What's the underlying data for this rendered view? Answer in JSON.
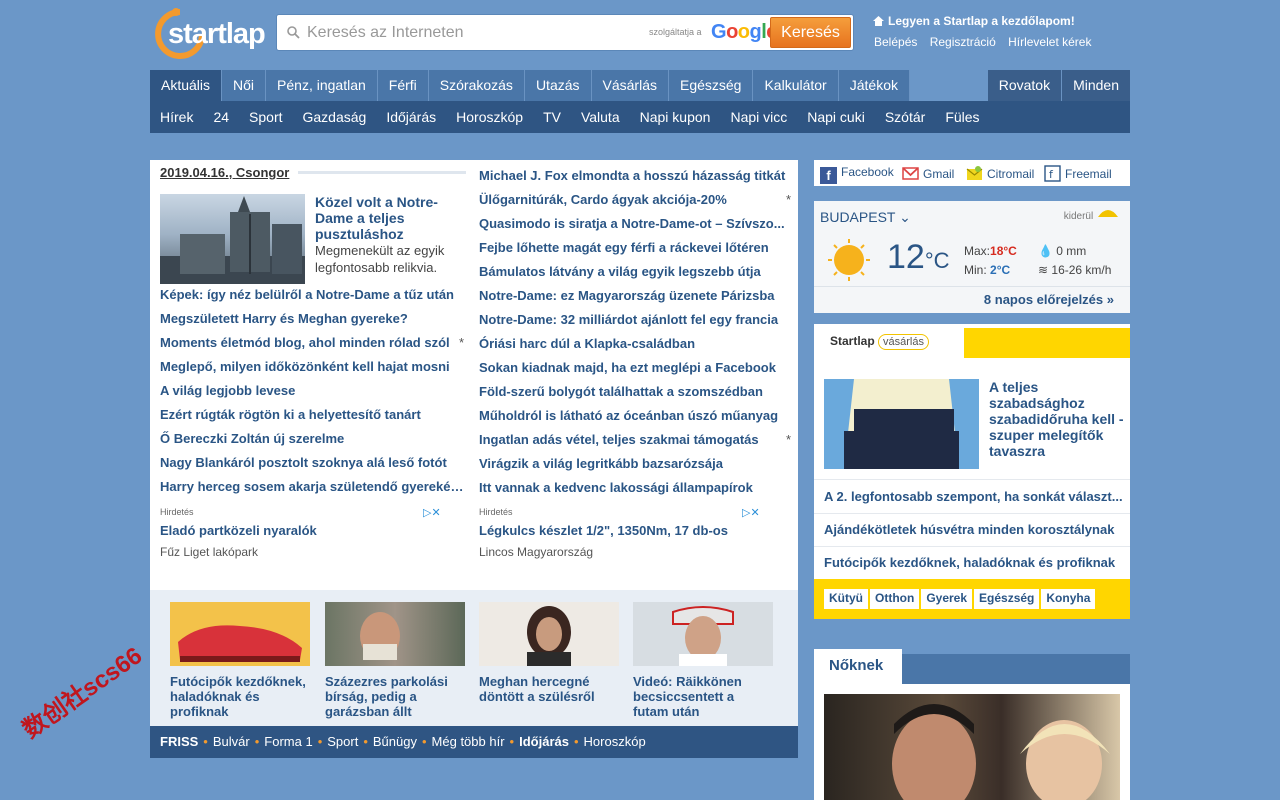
{
  "header": {
    "logo_text": "startlap",
    "search_placeholder": "Keresés az Interneten",
    "powered_by": "szolgáltatja a",
    "google": "Google",
    "search_button": "Keresés",
    "homepage_link": "Legyen a Startlap a kezdőlapom!",
    "user_links": [
      "Belépés",
      "Regisztráció",
      "Hírlevelet kérek"
    ]
  },
  "nav_primary": [
    "Aktuális",
    "Női",
    "Pénz, ingatlan",
    "Férfi",
    "Szórakozás",
    "Utazás",
    "Vásárlás",
    "Egészség",
    "Kalkulátor",
    "Játékok"
  ],
  "nav_primary_right": [
    "Rovatok",
    "Minden"
  ],
  "nav_secondary": [
    "Hírek",
    "24",
    "Sport",
    "Gazdaság",
    "Időjárás",
    "Horoszkóp",
    "TV",
    "Valuta",
    "Napi kupon",
    "Napi vicc",
    "Napi cuki",
    "Szótár",
    "Füles"
  ],
  "main": {
    "date": "2019.04.16.",
    "nameday": "Csongor",
    "lead_title": "Közel volt a Notre-Dame a teljes pusztuláshoz",
    "lead_desc": "Megmenekült az egyik legfontosabb relikvia.",
    "left_news": [
      {
        "text": "Képek: így néz belülről a Notre-Dame a tűz után",
        "star": ""
      },
      {
        "text": "Megszületett Harry és Meghan gyereke?",
        "star": ""
      },
      {
        "text": "Moments életmód blog, ahol minden rólad szól",
        "star": "*"
      },
      {
        "text": "Meglepő, milyen időközönként kell hajat mosni",
        "star": ""
      },
      {
        "text": "A világ legjobb levese",
        "star": ""
      },
      {
        "text": "Ezért rúgták rögtön ki a helyettesítő tanárt",
        "star": ""
      },
      {
        "text": "Ő Bereczki Zoltán új szerelme",
        "star": ""
      },
      {
        "text": "Nagy Blankáról posztolt szoknya alá leső fotót",
        "star": ""
      },
      {
        "text": "Harry herceg sosem akarja születendő gyerekét...",
        "star": ""
      }
    ],
    "right_news": [
      {
        "text": "Michael J. Fox elmondta a hosszú házasság titkát",
        "star": ""
      },
      {
        "text": "Ülőgarnitúrák, Cardo ágyak akciója-20%",
        "star": "*"
      },
      {
        "text": "Quasimodo is siratja a Notre-Dame-ot – Szívszo...",
        "star": ""
      },
      {
        "text": "Fejbe lőhette magát egy férfi a ráckevei lőtéren",
        "star": ""
      },
      {
        "text": "Bámulatos látvány a világ egyik legszebb útja",
        "star": ""
      },
      {
        "text": "Notre-Dame: ez Magyarország üzenete Párizsba",
        "star": ""
      },
      {
        "text": "Notre-Dame: 32 milliárdot ajánlott fel egy francia",
        "star": ""
      },
      {
        "text": "Óriási harc dúl a Klapka-családban",
        "star": ""
      },
      {
        "text": "Sokan kiadnak majd, ha ezt meglépi a Facebook",
        "star": ""
      },
      {
        "text": "Föld-szerű bolygót találhattak a szomszédban",
        "star": ""
      },
      {
        "text": "Műholdról is látható az óceánban úszó műanyag",
        "star": ""
      },
      {
        "text": "Ingatlan adás vétel, teljes szakmai támogatás",
        "star": "*"
      },
      {
        "text": "Virágzik a világ legritkább bazsarózsája",
        "star": ""
      },
      {
        "text": "Itt vannak a kedvenc lakossági állampapírok",
        "star": ""
      }
    ],
    "ad_left": {
      "label": "Hirdetés",
      "title": "Eladó partközeli nyaralók",
      "sub": "Fűz Liget lakópark"
    },
    "ad_right": {
      "label": "Hirdetés",
      "title": "Légkulcs készlet 1/2\", 1350Nm, 17 db-os",
      "sub": "Lincos Magyarország"
    }
  },
  "thumbs": [
    {
      "caption": "Futócipők kezdőknek, haladóknak és profiknak",
      "color": "#f3c24a"
    },
    {
      "caption": "Százezres parkolási bírság, pedig a garázsban állt",
      "color": "#7c8a78"
    },
    {
      "caption": "Meghan hercegné döntött a szülésről",
      "color": "#e8e2da"
    },
    {
      "caption": "Videó: Räikkönen becsiccsentett a futam után",
      "color": "#d7dde2"
    }
  ],
  "friss": {
    "label": "FRISS",
    "items": [
      "Bulvár",
      "Forma 1",
      "Sport",
      "Bűnügy",
      "Még több hír",
      "Időjárás",
      "Horoszkóp"
    ]
  },
  "mail": [
    "Facebook",
    "Gmail",
    "Citromail",
    "Freemail"
  ],
  "weather": {
    "city": "BUDAPEST",
    "provider": "kiderül",
    "temp": "12",
    "unit": "°C",
    "max_label": "Max:",
    "max": "18°C",
    "min_label": "Min:",
    "min": "2°C",
    "rain": "0 mm",
    "wind": "16-26 km/h",
    "forecast_link": "8 napos előrejelzés »"
  },
  "shop": {
    "tab_label": "Startlap",
    "tab_label2": "vásárlás",
    "feature_title": "A teljes szabadsághoz szabadidőruha kell - szuper melegítők tavaszra",
    "items": [
      "A 2. legfontosabb szempont, ha sonkát választ...",
      "Ajándékötletek húsvétra minden korosztálynak",
      "Futócipők kezdőknek, haladóknak és profiknak"
    ],
    "categories": [
      "Kütyü",
      "Otthon",
      "Gyerek",
      "Egészség",
      "Konyha"
    ]
  },
  "noknek": {
    "tab_label": "Nőknek"
  },
  "watermark": "数创社scs66"
}
